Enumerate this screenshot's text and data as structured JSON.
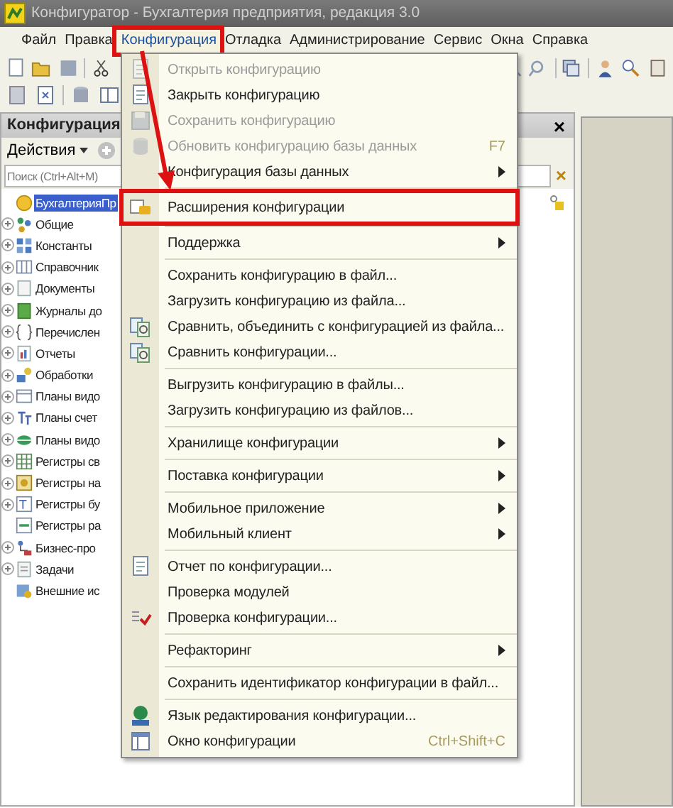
{
  "window": {
    "title": "Конфигуратор - Бухгалтерия предприятия, редакция 3.0"
  },
  "menu_bar": [
    {
      "label": "Файл",
      "selected": false
    },
    {
      "label": "Правка",
      "selected": false
    },
    {
      "label": "Конфигурация",
      "selected": true,
      "annotated": true
    },
    {
      "label": "Отладка",
      "selected": false
    },
    {
      "label": "Администрирование",
      "selected": false
    },
    {
      "label": "Сервис",
      "selected": false
    },
    {
      "label": "Окна",
      "selected": false
    },
    {
      "label": "Справка",
      "selected": false
    }
  ],
  "panel": {
    "title": "Конфигурация",
    "close": "×",
    "actions": "Действия",
    "search": {
      "placeholder": "Поиск (Ctrl+Alt+M)",
      "clear": "×"
    },
    "tree": [
      {
        "label": "БухгалтерияПр",
        "selected": true,
        "expandable": false
      },
      {
        "label": "Общие",
        "selected": false,
        "expandable": true
      },
      {
        "label": "Константы",
        "selected": false,
        "expandable": true
      },
      {
        "label": "Справочник",
        "selected": false,
        "expandable": true
      },
      {
        "label": "Документы",
        "selected": false,
        "expandable": true
      },
      {
        "label": "Журналы до",
        "selected": false,
        "expandable": true
      },
      {
        "label": "Перечислен",
        "selected": false,
        "expandable": true
      },
      {
        "label": "Отчеты",
        "selected": false,
        "expandable": true
      },
      {
        "label": "Обработки",
        "selected": false,
        "expandable": true
      },
      {
        "label": "Планы видо",
        "selected": false,
        "expandable": true
      },
      {
        "label": "Планы счет",
        "selected": false,
        "expandable": true
      },
      {
        "label": "Планы видо",
        "selected": false,
        "expandable": true
      },
      {
        "label": "Регистры св",
        "selected": false,
        "expandable": true
      },
      {
        "label": "Регистры на",
        "selected": false,
        "expandable": true
      },
      {
        "label": "Регистры бу",
        "selected": false,
        "expandable": true
      },
      {
        "label": "Регистры ра",
        "selected": false,
        "expandable": false
      },
      {
        "label": "Бизнес-про",
        "selected": false,
        "expandable": true
      },
      {
        "label": "Задачи",
        "selected": false,
        "expandable": true
      },
      {
        "label": "Внешние ис",
        "selected": false,
        "expandable": false
      }
    ]
  },
  "dropdown": [
    {
      "label": "Открыть конфигурацию",
      "disabled": true,
      "kind": "doc"
    },
    {
      "label": "Закрыть конфигурацию",
      "disabled": false,
      "kind": "doc"
    },
    {
      "label": "Сохранить конфигурацию",
      "disabled": true,
      "kind": "disk"
    },
    {
      "label": "Обновить конфигурацию базы данных",
      "disabled": true,
      "kind": "db",
      "shortcut": "F7"
    },
    {
      "label": "Конфигурация базы данных",
      "disabled": false,
      "submenu": true
    },
    {
      "label": "Расширения конфигурации",
      "disabled": false,
      "kind": "ext",
      "separator_before": true,
      "annotated": true
    },
    {
      "label": "Поддержка",
      "disabled": false,
      "submenu": true,
      "separator_before": true
    },
    {
      "label": "Сохранить конфигурацию в файл...",
      "disabled": false,
      "separator_before": true
    },
    {
      "label": "Загрузить конфигурацию из файла...",
      "disabled": false
    },
    {
      "label": "Сравнить, объединить с конфигурацией из файла...",
      "disabled": false,
      "kind": "compare"
    },
    {
      "label": "Сравнить конфигурации...",
      "disabled": false,
      "kind": "compare"
    },
    {
      "label": "Выгрузить конфигурацию в файлы...",
      "disabled": false,
      "separator_before": true
    },
    {
      "label": "Загрузить конфигурацию из файлов...",
      "disabled": false
    },
    {
      "label": "Хранилище конфигурации",
      "disabled": false,
      "submenu": true,
      "separator_before": true
    },
    {
      "label": "Поставка конфигурации",
      "disabled": false,
      "submenu": true,
      "separator_before": true
    },
    {
      "label": "Мобильное приложение",
      "disabled": false,
      "submenu": true,
      "separator_before": true
    },
    {
      "label": "Мобильный клиент",
      "disabled": false,
      "submenu": true
    },
    {
      "label": "Отчет по конфигурации...",
      "disabled": false,
      "kind": "doc",
      "separator_before": true
    },
    {
      "label": "Проверка модулей",
      "disabled": false
    },
    {
      "label": "Проверка конфигурации...",
      "disabled": false,
      "kind": "check"
    },
    {
      "label": "Рефакторинг",
      "disabled": false,
      "submenu": true,
      "separator_before": true
    },
    {
      "label": "Сохранить идентификатор конфигурации в файл...",
      "disabled": false,
      "separator_before": true
    },
    {
      "label": "Язык редактирования конфигурации...",
      "disabled": false,
      "kind": "globe",
      "separator_before": true
    },
    {
      "label": "Окно конфигурации",
      "disabled": false,
      "kind": "window",
      "shortcut": "Ctrl+Shift+C"
    }
  ]
}
